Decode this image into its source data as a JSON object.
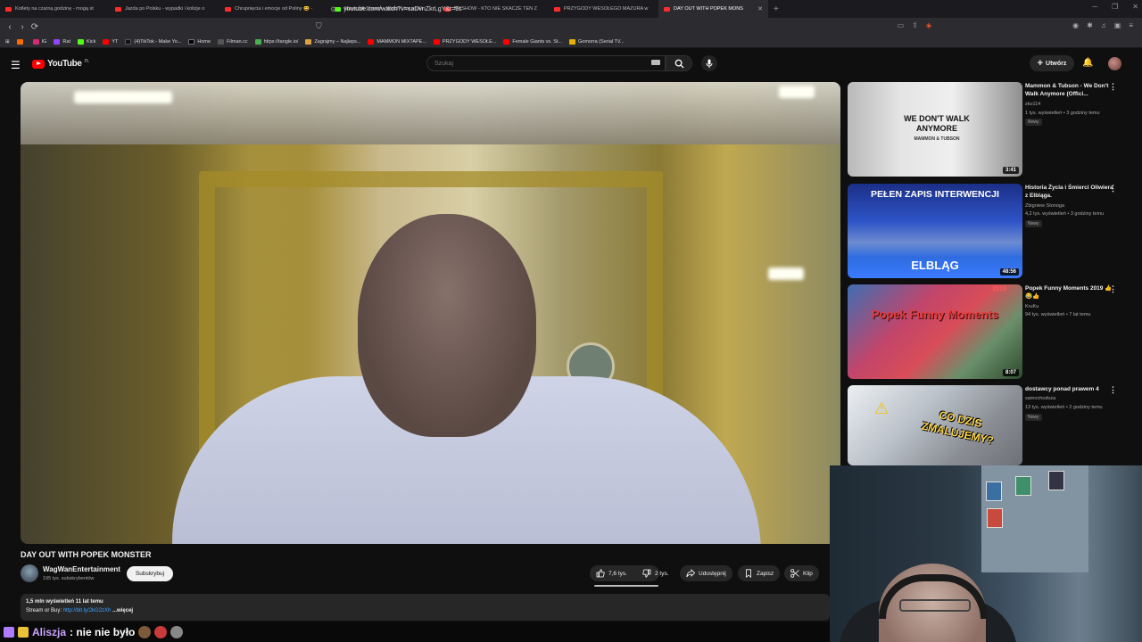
{
  "browser": {
    "tabs": [
      {
        "label": "Kotlety na czarną godzinę - mogą st",
        "icon": "youtube-favicon"
      },
      {
        "label": "Jazda po Polsku - wypadki i kolizje o",
        "icon": "youtube-favicon"
      },
      {
        "label": "Chrupnięcia i emocje od Poliny 😆 -",
        "icon": "youtube-favicon"
      },
      {
        "label": "Minecraft Stream - Watch Live on Ki",
        "icon": "kick-favicon"
      },
      {
        "label": "MYSHOW - KTO NIE SKACZE TEN Z",
        "icon": "youtube-favicon"
      },
      {
        "label": "PRZYGODY WESOŁEGO MAZURA w",
        "icon": "youtube-favicon"
      },
      {
        "label": "DAY OUT WITH POPEK MONS",
        "icon": "youtube-favicon",
        "active": true
      }
    ],
    "url": "youtube.com/watch?v=saDvnZkrLgY&t=5s",
    "bookmarks": [
      "",
      "IG",
      "Rat",
      "Kick",
      "YT",
      "(4)TikTok - Make Yo...",
      "Home",
      "Filman.cc",
      "https://tangle.io/",
      "Zagrajmy – Najleps...",
      "MAMMON MIXTAPE...",
      "PRZYGODY WESOŁE...",
      "Female Giants vs. St...",
      "Gomorra (Serial TV..."
    ]
  },
  "youtube": {
    "logo_text": "YouTube",
    "logo_region": "PL",
    "search_placeholder": "Szukaj",
    "create_label": "Utwórz"
  },
  "video": {
    "title": "DAY OUT WITH POPEK MONSTER",
    "channel": "WagWanEntertainment",
    "subscribers": "195 tys. subskrybentów",
    "subscribe_label": "Subskrybuj",
    "likes": "7,6 tys.",
    "dislikes": "2 tys.",
    "share_label": "Udostępnij",
    "save_label": "Zapisz",
    "clip_label": "Klip",
    "views_line": "1,5 mln wyświetleń  11 lat temu",
    "desc_prefix": "Stream or Buy: ",
    "desc_link": "http://bit.ly/2kG2zXh",
    "desc_more": " ...więcej"
  },
  "recommendations": [
    {
      "title": "Mammon & Tubson - We Don't Walk Anymore (Offici...",
      "channel": "zko114",
      "meta": "1 tys. wyświetleń • 3 godziny temu",
      "badge": "Nowy",
      "duration": "3:41",
      "thumb_text": "WE DON'T WALK ANYMORE",
      "thumb_sub": "MAMMON & TUBSON"
    },
    {
      "title": "Historia Życia i Śmierci Oliwiera z Elbląga.",
      "channel": "Zbigniew Stonoga",
      "meta": "4,2 tys. wyświetleń • 3 godziny temu",
      "badge": "Nowy",
      "duration": "48:56",
      "thumb_text": "PEŁEN ZAPIS INTERWENCJI",
      "thumb_sub": "ELBLĄG"
    },
    {
      "title": "Popek Funny Moments 2019 👍😂👍",
      "channel": "KruKu",
      "meta": "94 tys. wyświetleń • 7 lat temu",
      "badge": "",
      "duration": "8:07",
      "thumb_text": "Popek Funny Moments",
      "thumb_sub": "2019"
    },
    {
      "title": "dostawcy ponad prawem 4",
      "channel": "samochodoza",
      "meta": "13 tys. wyświetleń • 2 godziny temu",
      "badge": "Nowy",
      "duration": "",
      "thumb_text": "CO DZIS ZMALUJEMY?",
      "thumb_sub": ""
    }
  ],
  "chat": {
    "username": "Aliszja",
    "message": ": nie nie było"
  }
}
